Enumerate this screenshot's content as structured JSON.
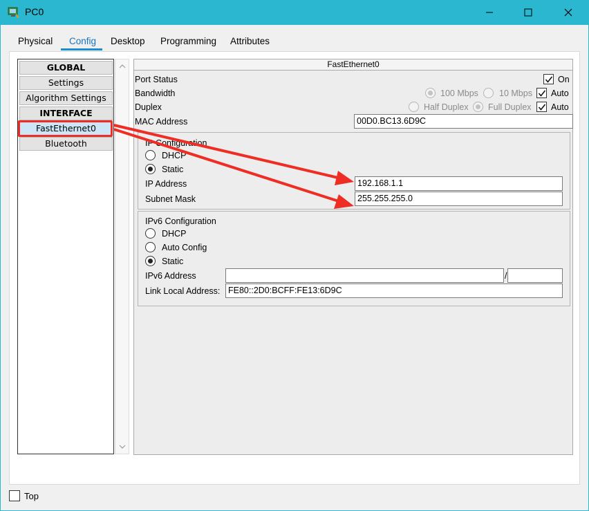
{
  "window": {
    "title": "PC0",
    "controls": [
      "minimize-icon",
      "maximize-icon",
      "close-icon"
    ]
  },
  "tabs": [
    {
      "label": "Physical",
      "active": false
    },
    {
      "label": "Config",
      "active": true
    },
    {
      "label": "Desktop",
      "active": false
    },
    {
      "label": "Programming",
      "active": false
    },
    {
      "label": "Attributes",
      "active": false
    }
  ],
  "sidebar": {
    "items": [
      {
        "label": "GLOBAL",
        "kind": "header"
      },
      {
        "label": "Settings",
        "kind": "item"
      },
      {
        "label": "Algorithm Settings",
        "kind": "item"
      },
      {
        "label": "INTERFACE",
        "kind": "header"
      },
      {
        "label": "FastEthernet0",
        "kind": "item",
        "selected": true
      },
      {
        "label": "Bluetooth",
        "kind": "item"
      }
    ]
  },
  "panel": {
    "title": "FastEthernet0",
    "port_status": {
      "label": "Port Status",
      "on_label": "On",
      "on": true
    },
    "bandwidth": {
      "label": "Bandwidth",
      "opt1": "100 Mbps",
      "opt2": "10 Mbps",
      "auto_label": "Auto",
      "auto": true
    },
    "duplex": {
      "label": "Duplex",
      "opt1": "Half Duplex",
      "opt2": "Full Duplex",
      "auto_label": "Auto",
      "auto": true
    },
    "mac": {
      "label": "MAC Address",
      "value": "00D0.BC13.6D9C"
    },
    "ipv4": {
      "title": "IP Configuration",
      "dhcp_label": "DHCP",
      "static_label": "Static",
      "mode": "Static",
      "ip_label": "IP Address",
      "ip_value": "192.168.1.1",
      "mask_label": "Subnet Mask",
      "mask_value": "255.255.255.0"
    },
    "ipv6": {
      "title": "IPv6 Configuration",
      "dhcp_label": "DHCP",
      "auto_label": "Auto Config",
      "static_label": "Static",
      "mode": "Static",
      "addr_label": "IPv6 Address",
      "addr_value": "",
      "prefix_sep": "/",
      "prefix_value": "",
      "link_local_label": "Link Local Address:",
      "link_local_value": "FE80::2D0:BCFF:FE13:6D9C"
    }
  },
  "footer": {
    "top_label": "Top",
    "top_checked": false
  },
  "colors": {
    "titlebar": "#2bb7cf",
    "accent": "#1a8fd0",
    "annotation": "#ee2e24"
  }
}
